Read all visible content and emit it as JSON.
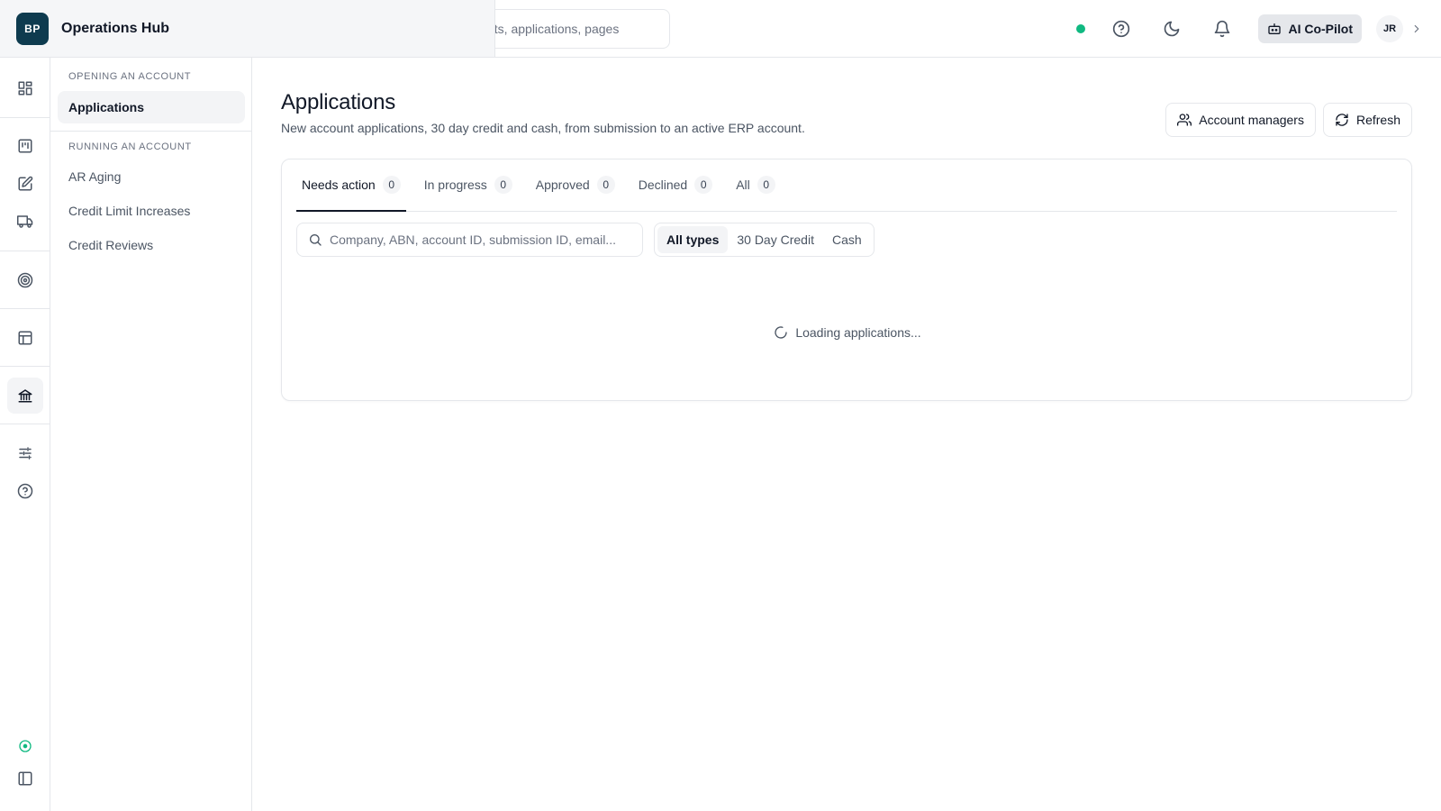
{
  "brand": {
    "logo_text": "BP",
    "title": "Operations Hub"
  },
  "global_search": {
    "placeholder_visible": "nts, applications, pages"
  },
  "topbar": {
    "status_color": "#10b981",
    "copilot_label": "AI Co-Pilot",
    "avatar_initials": "JR"
  },
  "rail": {
    "icons": [
      "dashboard-icon",
      "kanban-icon",
      "edit-document-icon",
      "truck-icon",
      "target-icon",
      "table-icon",
      "bank-icon",
      "sliders-icon",
      "help-icon"
    ],
    "bottom_icons": [
      "status-circle-icon",
      "sidebar-toggle-icon"
    ],
    "active": "bank-icon"
  },
  "subnav": {
    "section_opening": "OPENING AN ACCOUNT",
    "opening_items": [
      {
        "label": "Applications",
        "active": true
      }
    ],
    "section_running": "RUNNING AN ACCOUNT",
    "running_items": [
      {
        "label": "AR Aging"
      },
      {
        "label": "Credit Limit Increases"
      },
      {
        "label": "Credit Reviews"
      }
    ]
  },
  "page": {
    "title": "Applications",
    "subtitle": "New account applications, 30 day credit and cash, from submission to an active ERP account.",
    "actions": {
      "account_managers": "Account managers",
      "refresh": "Refresh"
    }
  },
  "tabs": [
    {
      "label": "Needs action",
      "count": "0",
      "active": true
    },
    {
      "label": "In progress",
      "count": "0"
    },
    {
      "label": "Approved",
      "count": "0"
    },
    {
      "label": "Declined",
      "count": "0"
    },
    {
      "label": "All",
      "count": "0"
    }
  ],
  "filters": {
    "search_placeholder": "Company, ABN, account ID, submission ID, email...",
    "types": [
      "All types",
      "30 Day Credit",
      "Cash"
    ],
    "active_type": "All types"
  },
  "loading_text": "Loading applications...",
  "colors": {
    "brand": "#0e3b4f",
    "accent_green": "#10b981"
  }
}
